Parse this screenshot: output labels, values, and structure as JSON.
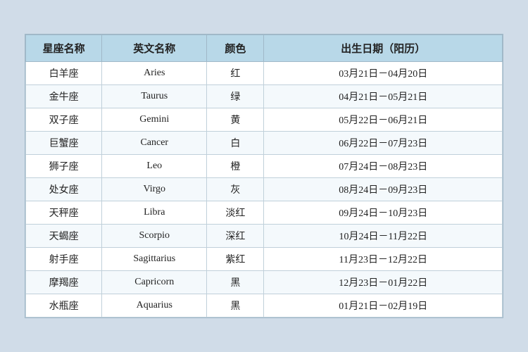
{
  "table": {
    "headers": [
      "星座名称",
      "英文名称",
      "颜色",
      "出生日期（阳历）"
    ],
    "rows": [
      {
        "zodiac": "白羊座",
        "english": "Aries",
        "color": "红",
        "date": "03月21日－04月20日"
      },
      {
        "zodiac": "金牛座",
        "english": "Taurus",
        "color": "绿",
        "date": "04月21日－05月21日"
      },
      {
        "zodiac": "双子座",
        "english": "Gemini",
        "color": "黄",
        "date": "05月22日－06月21日"
      },
      {
        "zodiac": "巨蟹座",
        "english": "Cancer",
        "color": "白",
        "date": "06月22日－07月23日"
      },
      {
        "zodiac": "狮子座",
        "english": "Leo",
        "color": "橙",
        "date": "07月24日－08月23日"
      },
      {
        "zodiac": "处女座",
        "english": "Virgo",
        "color": "灰",
        "date": "08月24日－09月23日"
      },
      {
        "zodiac": "天秤座",
        "english": "Libra",
        "color": "淡红",
        "date": "09月24日－10月23日"
      },
      {
        "zodiac": "天蝎座",
        "english": "Scorpio",
        "color": "深红",
        "date": "10月24日－11月22日"
      },
      {
        "zodiac": "射手座",
        "english": "Sagittarius",
        "color": "紫红",
        "date": "11月23日－12月22日"
      },
      {
        "zodiac": "摩羯座",
        "english": "Capricorn",
        "color": "黑",
        "date": "12月23日－01月22日"
      },
      {
        "zodiac": "水瓶座",
        "english": "Aquarius",
        "color": "黑",
        "date": "01月21日－02月19日"
      }
    ]
  }
}
